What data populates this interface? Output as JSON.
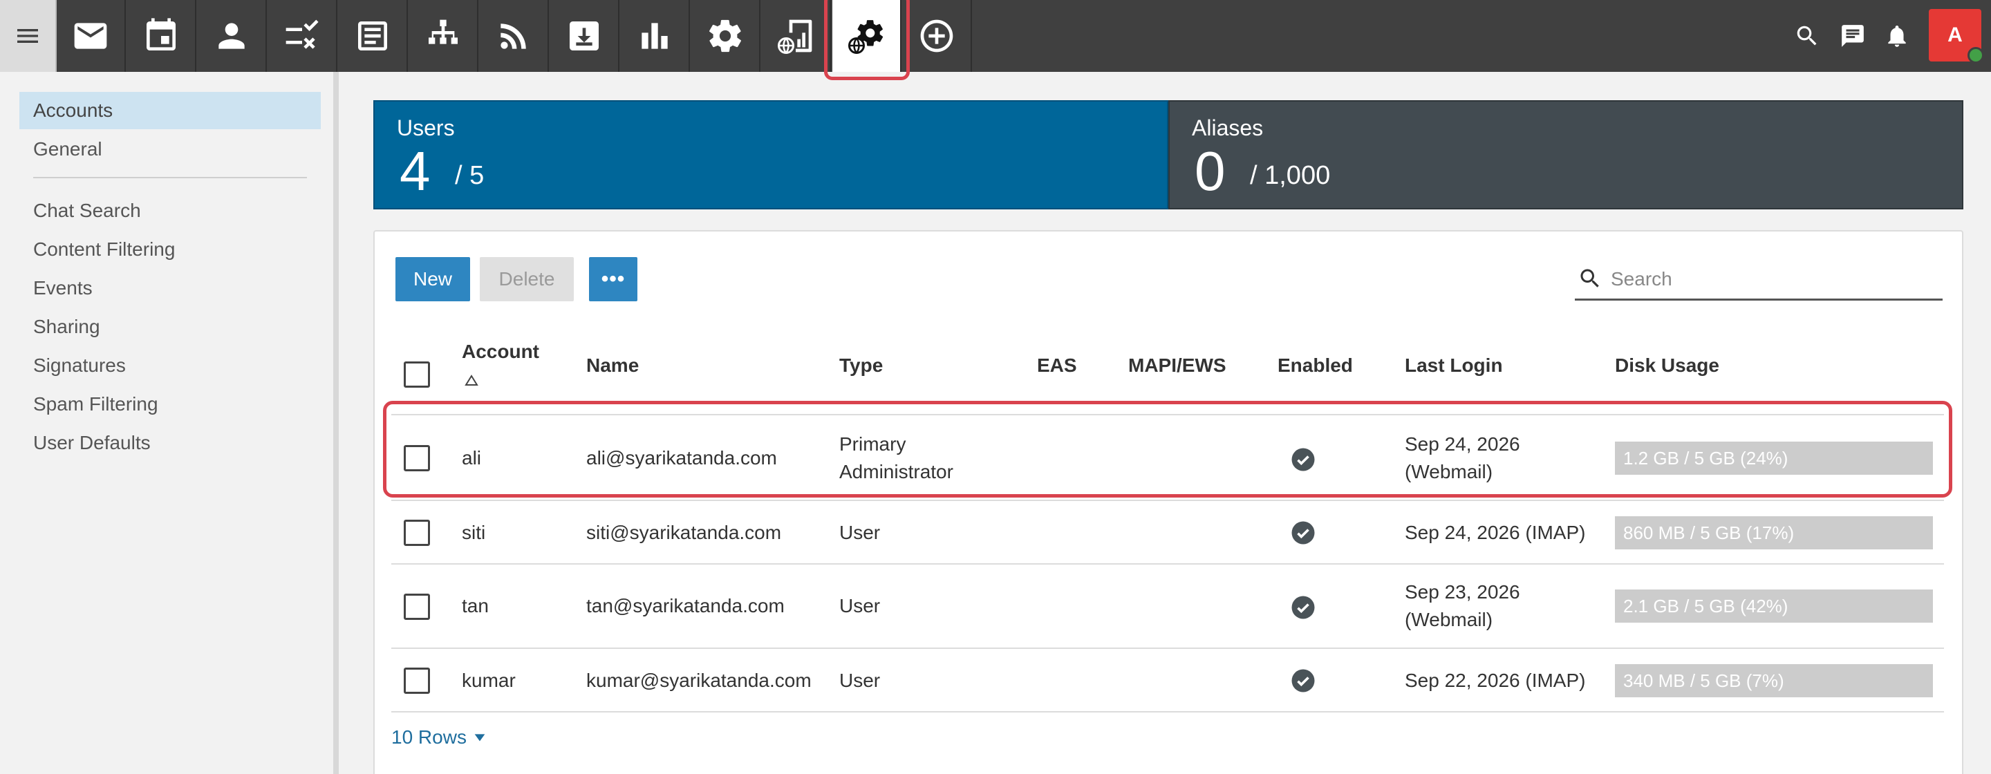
{
  "topbar": {
    "apps": [
      {
        "icon": "mail-icon"
      },
      {
        "icon": "calendar-icon"
      },
      {
        "icon": "contacts-icon"
      },
      {
        "icon": "tasks-icon"
      },
      {
        "icon": "notes-icon"
      },
      {
        "icon": "sitemap-icon"
      },
      {
        "icon": "rss-icon"
      },
      {
        "icon": "archive-icon"
      },
      {
        "icon": "reports-icon"
      },
      {
        "icon": "settings-icon"
      },
      {
        "icon": "domain-reports-icon"
      },
      {
        "icon": "domain-settings-icon",
        "active": true
      },
      {
        "icon": "add-circle-icon"
      }
    ],
    "avatar_letter": "A"
  },
  "sidebar": {
    "items": [
      {
        "label": "Accounts",
        "active": true
      },
      {
        "label": "General"
      },
      {
        "label": "Chat Search"
      },
      {
        "label": "Content Filtering"
      },
      {
        "label": "Events"
      },
      {
        "label": "Sharing"
      },
      {
        "label": "Signatures"
      },
      {
        "label": "Spam Filtering"
      },
      {
        "label": "User Defaults"
      }
    ]
  },
  "stats": {
    "users": {
      "label": "Users",
      "count": "4",
      "total": "/ 5"
    },
    "aliases": {
      "label": "Aliases",
      "count": "0",
      "total": "/ 1,000"
    }
  },
  "toolbar": {
    "new_label": "New",
    "delete_label": "Delete",
    "more_label": "•••",
    "search_placeholder": "Search"
  },
  "table": {
    "columns": [
      "Account",
      "Name",
      "Type",
      "EAS",
      "MAPI/EWS",
      "Enabled",
      "Last Login",
      "Disk Usage"
    ],
    "rows": [
      {
        "account": "ali",
        "name": "ali@syarikatanda.com",
        "type_line1": "Primary",
        "type_line2": "Administrator",
        "login_line1": "Sep 24, 2026",
        "login_line2": "(Webmail)",
        "disk": "1.2 GB / 5 GB (24%)"
      },
      {
        "account": "siti",
        "name": "siti@syarikatanda.com",
        "type_line1": "User",
        "type_line2": "",
        "login_line1": "Sep 24, 2026 (IMAP)",
        "login_line2": "",
        "disk": "860 MB / 5 GB (17%)"
      },
      {
        "account": "tan",
        "name": "tan@syarikatanda.com",
        "type_line1": "User",
        "type_line2": "",
        "login_line1": "Sep 23, 2026",
        "login_line2": "(Webmail)",
        "disk": "2.1 GB / 5 GB (42%)"
      },
      {
        "account": "kumar",
        "name": "kumar@syarikatanda.com",
        "type_line1": "User",
        "type_line2": "",
        "login_line1": "Sep 22, 2026 (IMAP)",
        "login_line2": "",
        "disk": "340 MB / 5 GB (7%)"
      }
    ],
    "rows_per_page": "10 Rows"
  },
  "colors": {
    "accent": "#006699",
    "button": "#2e86c1",
    "highlight": "#d9434e"
  }
}
